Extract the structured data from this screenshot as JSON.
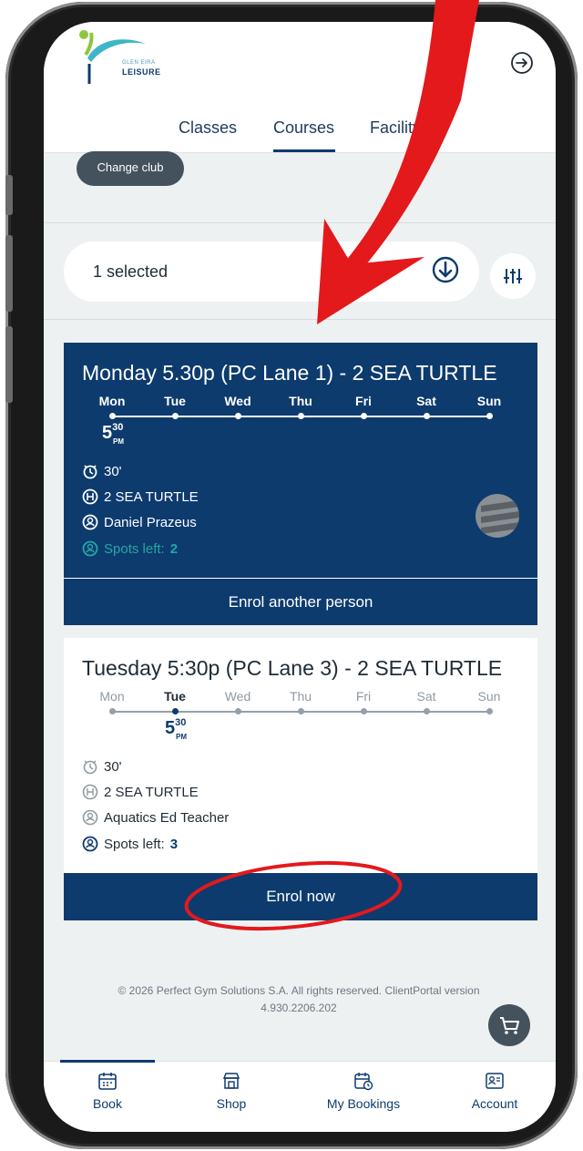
{
  "brand": {
    "logo_small": "GLEN EIRA",
    "logo_big": "LEISURE"
  },
  "tabs": [
    {
      "label": "Classes"
    },
    {
      "label": "Courses",
      "active": true
    },
    {
      "label": "Facility"
    }
  ],
  "change_club_label": "Change club",
  "filter": {
    "selected_text": "1 selected"
  },
  "days": [
    "Mon",
    "Tue",
    "Wed",
    "Thu",
    "Fri",
    "Sat",
    "Sun"
  ],
  "cards": [
    {
      "title": "Monday 5.30p (PC Lane 1) - 2 SEA TURTLE",
      "active_day": "Mon",
      "time_hour": "5",
      "time_min": "30",
      "time_ampm": "PM",
      "duration": "30'",
      "level": "2 SEA TURTLE",
      "instructor": "Daniel Prazeus",
      "spots_label": "Spots left:",
      "spots_value": "2",
      "button_label": "Enrol another person"
    },
    {
      "title": "Tuesday 5:30p (PC Lane 3) - 2 SEA TURTLE",
      "active_day": "Tue",
      "time_hour": "5",
      "time_min": "30",
      "time_ampm": "PM",
      "duration": "30'",
      "level": "2 SEA TURTLE",
      "instructor": "Aquatics Ed Teacher",
      "spots_label": "Spots left:",
      "spots_value": "3",
      "button_label": "Enrol now"
    }
  ],
  "footer": {
    "copyright_line1": "© 2026 Perfect Gym Solutions S.A. All rights reserved. ClientPortal version",
    "copyright_line2": "4.930.2206.202"
  },
  "bottom_nav": [
    {
      "label": "Book",
      "icon": "calendar-icon",
      "active": true
    },
    {
      "label": "Shop",
      "icon": "shop-icon"
    },
    {
      "label": "My Bookings",
      "icon": "calendar-clock-icon"
    },
    {
      "label": "Account",
      "icon": "id-card-icon"
    }
  ],
  "colors": {
    "primary": "#0d3b6e",
    "accent_teal": "#23a7a3",
    "annotation_red": "#e3191c",
    "background": "#eef1f2"
  }
}
